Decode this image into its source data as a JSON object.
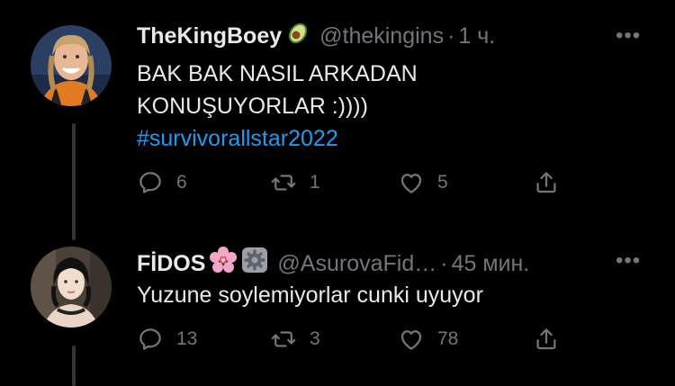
{
  "tweets": [
    {
      "display_name": "TheKingBoey",
      "handle": "@thekingins",
      "time": "1 ч.",
      "text_lines": [
        "BAK BAK NASIL ARKADAN",
        "KONUŞUYORLAR  :))))"
      ],
      "hashtag": "#survivorallstar2022",
      "replies": "6",
      "retweets": "1",
      "likes": "5",
      "emoji": "avocado-icon"
    },
    {
      "display_name": "FİDOS",
      "handle": "@AsurovaFid…",
      "time": "45 мин.",
      "text_lines": [
        "Yuzune soylemiyorlar cunki uyuyor"
      ],
      "replies": "13",
      "retweets": "3",
      "likes": "78",
      "emoji": "cherry-blossom-icon"
    }
  ],
  "separator": "·",
  "more_label": "•••",
  "colors": {
    "background": "#000000",
    "text": "#e7e9ea",
    "muted": "#71767b",
    "link": "#1d9bf0",
    "thread_line": "#333639"
  }
}
